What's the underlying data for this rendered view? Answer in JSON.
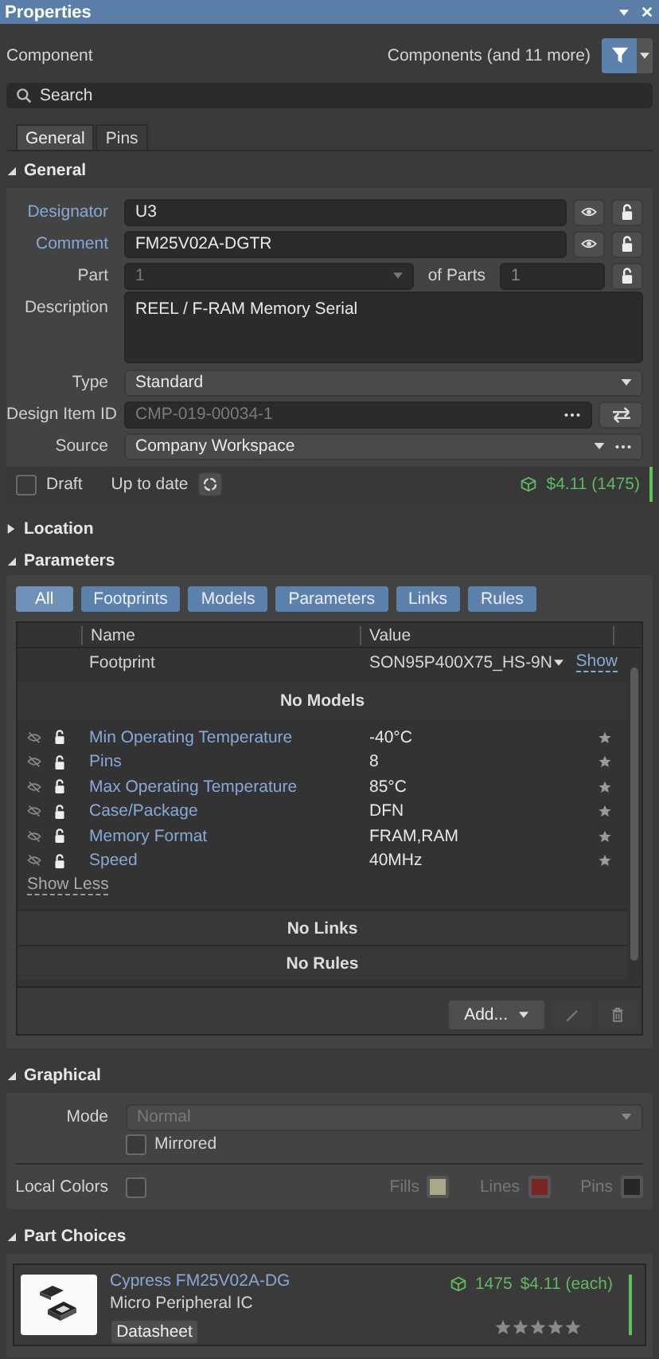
{
  "window": {
    "title": "Properties"
  },
  "header": {
    "object": "Component",
    "filter": "Components (and 11 more)"
  },
  "search": {
    "placeholder": "Search"
  },
  "tabs": [
    {
      "label": "General",
      "selected": true
    },
    {
      "label": "Pins",
      "selected": false
    }
  ],
  "general": {
    "title": "General",
    "expanded": true,
    "fields": [
      {
        "kind": "text",
        "label": "Designator",
        "value": "U3",
        "highlighted": true
      },
      {
        "kind": "text",
        "label": "Comment",
        "value": "FM25V02A-DGTR",
        "highlighted": true
      },
      {
        "kind": "part",
        "label": "Part",
        "value": "1",
        "disabled": true,
        "of_label": "of Parts",
        "of_value": "1",
        "highlighted": false
      },
      {
        "kind": "multiline",
        "label": "Description",
        "value": "REEL / F-RAM Memory Serial",
        "highlighted": false
      },
      {
        "kind": "select",
        "label": "Type",
        "value": "Standard",
        "highlighted": false
      },
      {
        "kind": "id",
        "label": "Design Item ID",
        "value": "CMP-019-00034-1",
        "disabled": true,
        "highlighted": false
      },
      {
        "kind": "source",
        "label": "Source",
        "value": "Company Workspace",
        "highlighted": false
      }
    ]
  },
  "status": {
    "draft": {
      "label": "Draft",
      "checked": false
    },
    "state": "Up to date",
    "price": "$4.11 (1475)"
  },
  "location": {
    "title": "Location",
    "expanded": false
  },
  "parameters": {
    "title": "Parameters",
    "expanded": true,
    "filters": [
      {
        "label": "All",
        "selected": true
      },
      {
        "label": "Footprints",
        "selected": false
      },
      {
        "label": "Models",
        "selected": false
      },
      {
        "label": "Parameters",
        "selected": false
      },
      {
        "label": "Links",
        "selected": false
      },
      {
        "label": "Rules",
        "selected": false
      }
    ],
    "columns": [
      "Name",
      "Value"
    ],
    "footprint": {
      "name": "Footprint",
      "value": "SON95P400X75_HS-9N",
      "link": "Show"
    },
    "models_note": "No Models",
    "rows": [
      {
        "name": "Min Operating Temperature",
        "value": "-40°C"
      },
      {
        "name": "Pins",
        "value": "8"
      },
      {
        "name": "Max Operating Temperature",
        "value": "85°C"
      },
      {
        "name": "Case/Package",
        "value": "DFN"
      },
      {
        "name": "Memory Format",
        "value": "FRAM,RAM"
      },
      {
        "name": "Speed",
        "value": "40MHz"
      }
    ],
    "show_less": "Show Less",
    "links_note": "No Links",
    "rules_note": "No Rules",
    "add": "Add..."
  },
  "graphical": {
    "title": "Graphical",
    "expanded": true,
    "mode": {
      "label": "Mode",
      "value": "Normal",
      "disabled": true
    },
    "mirrored": {
      "label": "Mirrored",
      "checked": false
    },
    "local_colors": {
      "label": "Local Colors",
      "checked": false
    },
    "swatches": [
      {
        "label": "Fills",
        "color": "#a9a98a"
      },
      {
        "label": "Lines",
        "color": "#7a2424"
      },
      {
        "label": "Pins",
        "color": "#262626"
      }
    ]
  },
  "part_choices": {
    "title": "Part Choices",
    "expanded": true,
    "items": [
      {
        "name": "Cypress FM25V02A-DG",
        "description": "Micro Peripheral IC",
        "stock": "1475",
        "price": "$4.11 (each)",
        "button": "Datasheet",
        "stars": 0
      }
    ]
  }
}
